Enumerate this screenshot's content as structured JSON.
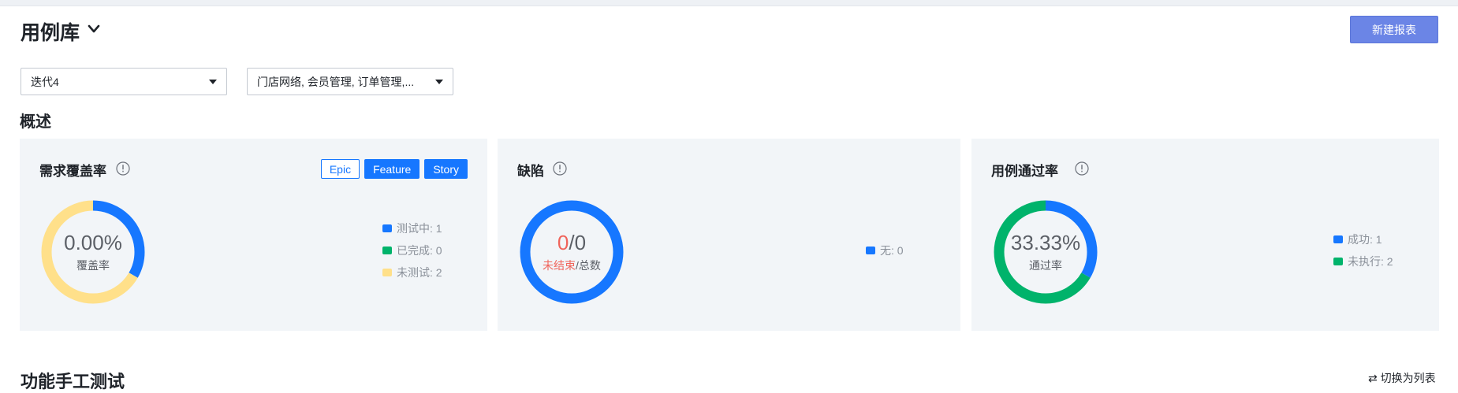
{
  "header": {
    "title": "用例库",
    "new_report_label": "新建报表"
  },
  "filters": {
    "iteration": "迭代4",
    "modules": "门店网络, 会员管理, 订单管理,..."
  },
  "overview": {
    "title": "概述",
    "coverage": {
      "title": "需求覆盖率",
      "tags": [
        "Epic",
        "Feature",
        "Story"
      ],
      "center_value": "0.00%",
      "center_label": "覆盖率",
      "legend": [
        {
          "label": "测试中: 1",
          "color": "#1677ff"
        },
        {
          "label": "已完成: 0",
          "color": "#00b36b"
        },
        {
          "label": "未测试: 2",
          "color": "#ffe08a"
        }
      ],
      "segments": [
        {
          "fraction": 0.3333,
          "color": "#1677ff"
        },
        {
          "fraction": 0.6667,
          "color": "#ffe08a"
        }
      ]
    },
    "defects": {
      "title": "缺陷",
      "open_count": "0",
      "separator": "/",
      "total_count": "0",
      "open_label": "未结束",
      "total_label": "/总数",
      "legend": [
        {
          "label": "无: 0",
          "color": "#1677ff"
        }
      ],
      "segments": [
        {
          "fraction": 1,
          "color": "#1677ff"
        }
      ]
    },
    "pass_rate": {
      "title": "用例通过率",
      "center_value": "33.33%",
      "center_label": "通过率",
      "legend": [
        {
          "label": "成功: 1",
          "color": "#1677ff"
        },
        {
          "label": "未执行: 2",
          "color": "#00b36b"
        }
      ],
      "segments": [
        {
          "fraction": 0.3333,
          "color": "#1677ff"
        },
        {
          "fraction": 0.6667,
          "color": "#00b36b"
        }
      ]
    }
  },
  "section2": {
    "title": "功能手工测试",
    "switch_label": "⇄ 切换为列表"
  }
}
